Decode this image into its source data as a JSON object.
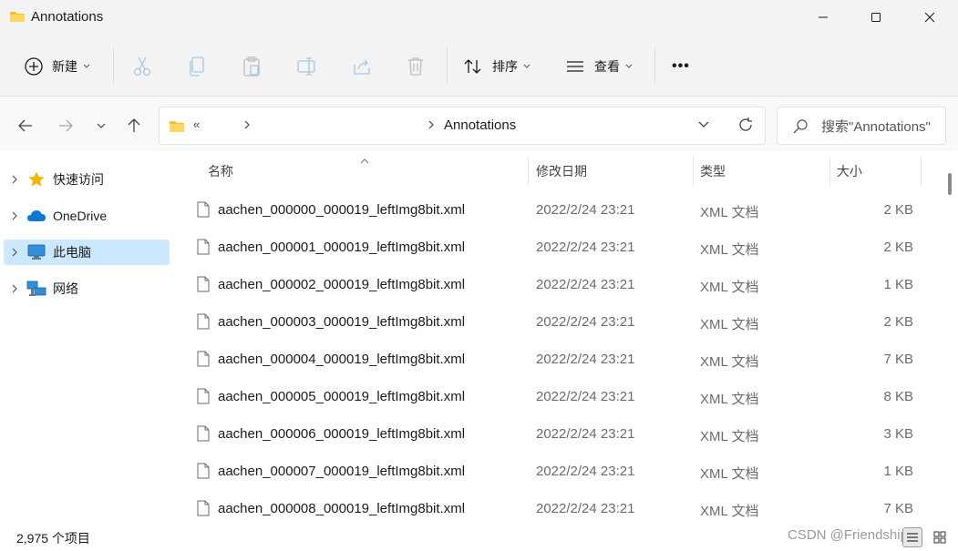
{
  "window": {
    "title": "Annotations",
    "icon": "folder-icon"
  },
  "toolbar": {
    "new_label": "新建",
    "sort_label": "排序",
    "view_label": "查看",
    "more_label": "•••"
  },
  "address": {
    "overflow": "«",
    "current": "Annotations"
  },
  "search": {
    "placeholder": "搜索\"Annotations\""
  },
  "sidebar": {
    "items": [
      {
        "label": "快速访问",
        "icon": "star-icon"
      },
      {
        "label": "OneDrive",
        "icon": "cloud-icon"
      },
      {
        "label": "此电脑",
        "icon": "monitor-icon",
        "selected": true
      },
      {
        "label": "网络",
        "icon": "network-icon"
      }
    ]
  },
  "columns": {
    "name": "名称",
    "date": "修改日期",
    "type": "类型",
    "size": "大小"
  },
  "files": [
    {
      "name": "aachen_000000_000019_leftImg8bit.xml",
      "date": "2022/2/24 23:21",
      "type": "XML 文档",
      "size": "2 KB"
    },
    {
      "name": "aachen_000001_000019_leftImg8bit.xml",
      "date": "2022/2/24 23:21",
      "type": "XML 文档",
      "size": "2 KB"
    },
    {
      "name": "aachen_000002_000019_leftImg8bit.xml",
      "date": "2022/2/24 23:21",
      "type": "XML 文档",
      "size": "1 KB"
    },
    {
      "name": "aachen_000003_000019_leftImg8bit.xml",
      "date": "2022/2/24 23:21",
      "type": "XML 文档",
      "size": "2 KB"
    },
    {
      "name": "aachen_000004_000019_leftImg8bit.xml",
      "date": "2022/2/24 23:21",
      "type": "XML 文档",
      "size": "7 KB"
    },
    {
      "name": "aachen_000005_000019_leftImg8bit.xml",
      "date": "2022/2/24 23:21",
      "type": "XML 文档",
      "size": "8 KB"
    },
    {
      "name": "aachen_000006_000019_leftImg8bit.xml",
      "date": "2022/2/24 23:21",
      "type": "XML 文档",
      "size": "3 KB"
    },
    {
      "name": "aachen_000007_000019_leftImg8bit.xml",
      "date": "2022/2/24 23:21",
      "type": "XML 文档",
      "size": "1 KB"
    },
    {
      "name": "aachen_000008_000019_leftImg8bit.xml",
      "date": "2022/2/24 23:21",
      "type": "XML 文档",
      "size": "7 KB"
    }
  ],
  "status": {
    "item_count": "2,975 个项目",
    "watermark": "CSDN @Friendship."
  },
  "colors": {
    "accent": "#0067c0",
    "selected_bg": "#cce8ff",
    "folder": "#f8c12b"
  }
}
